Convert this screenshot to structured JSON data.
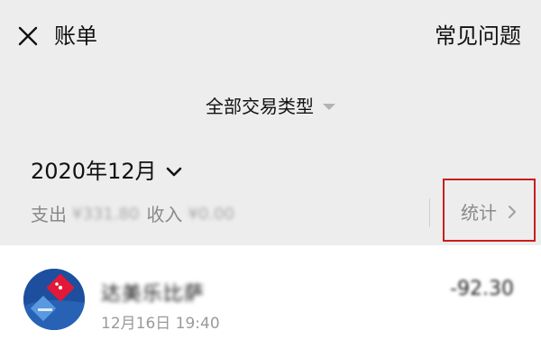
{
  "header": {
    "title": "账单",
    "faq_label": "常见问题"
  },
  "filter": {
    "label": "全部交易类型"
  },
  "month_section": {
    "month_label": "2020年12月",
    "expense_label": "支出",
    "expense_amount": "¥331.80",
    "income_label": "收入",
    "income_amount": "¥0.00",
    "stats_label": "统计"
  },
  "transactions": [
    {
      "merchant": "达美乐比萨",
      "datetime": "12月16日 19:40",
      "amount": "-92.30"
    }
  ],
  "colors": {
    "background": "#ededed",
    "list_background": "#ffffff",
    "highlight_border": "#c81e1e",
    "avatar_blue": "#1d4f9e",
    "avatar_red": "#e31837"
  }
}
